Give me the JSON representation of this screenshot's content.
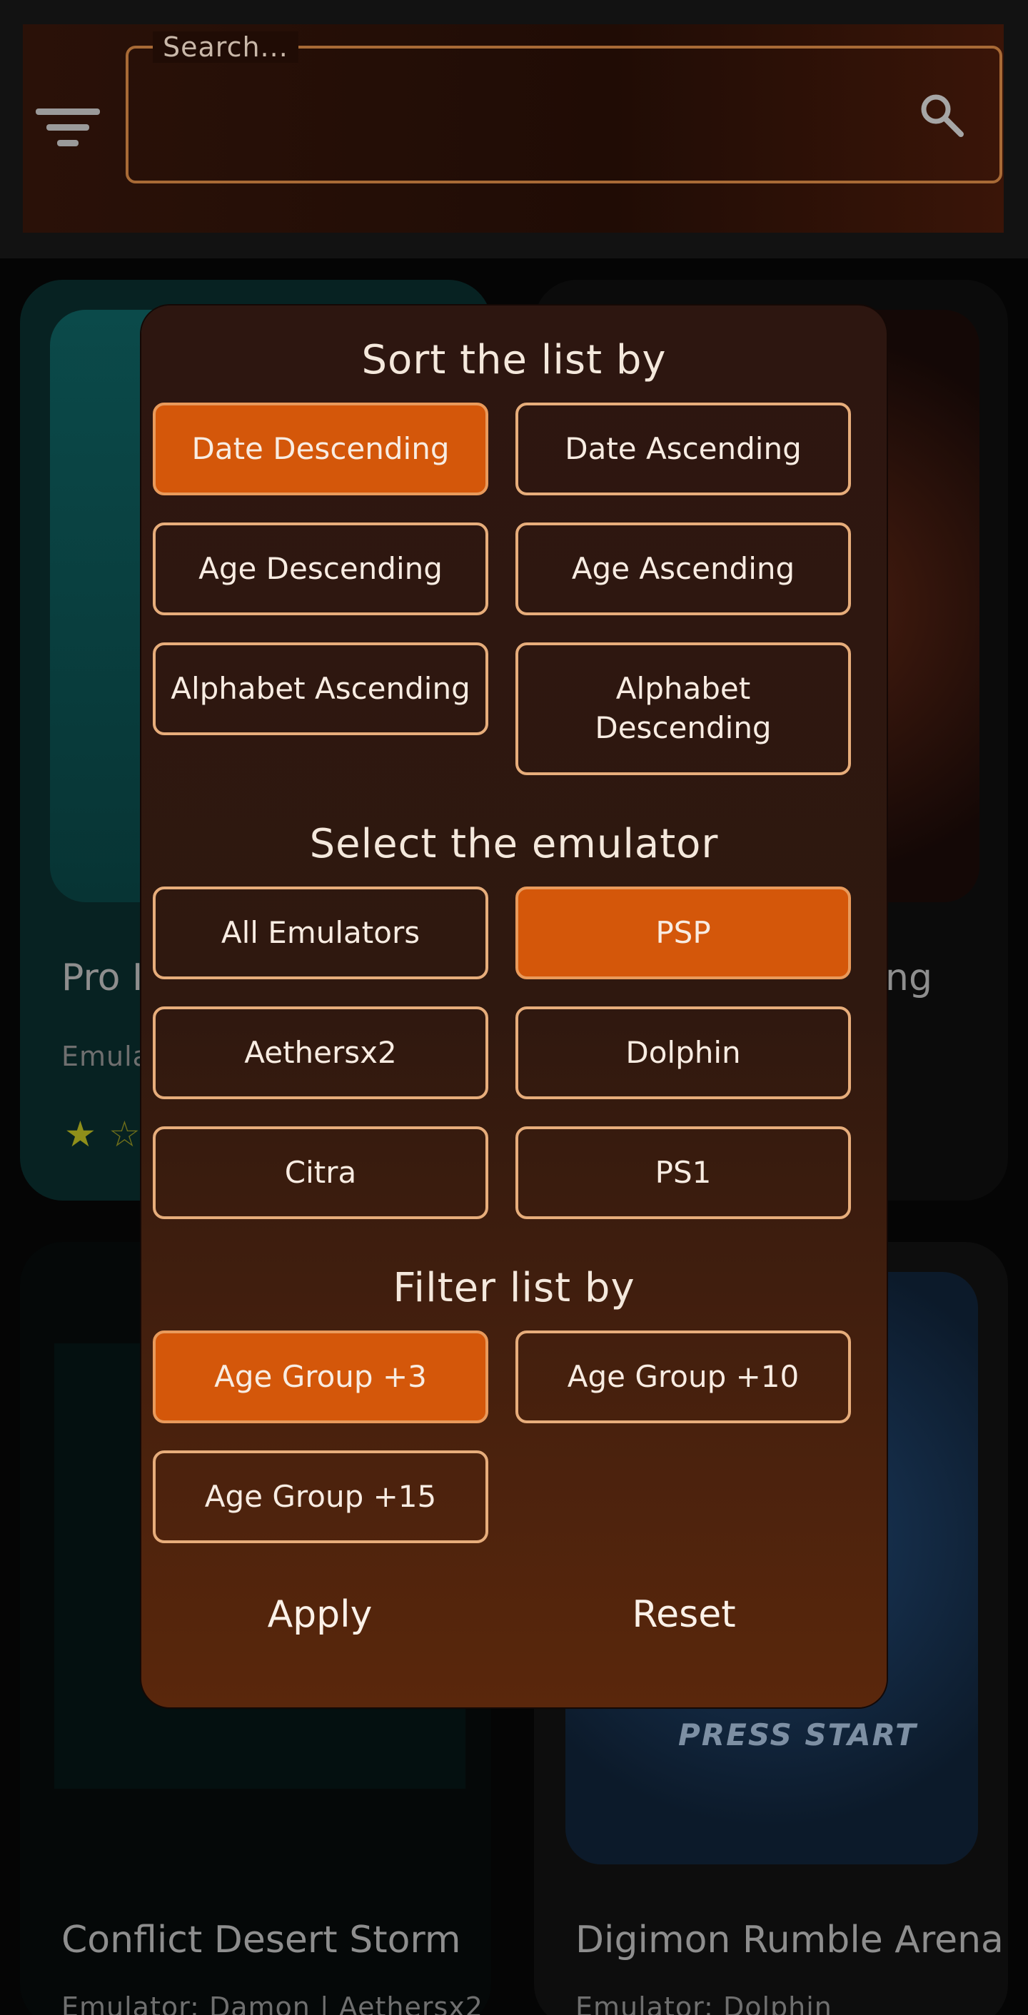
{
  "search": {
    "placeholder": "Search..."
  },
  "background_cards": {
    "card1": {
      "title": "Pro I",
      "subtitle": "Emula"
    },
    "card2": {
      "title_fragment": "ng"
    },
    "card3": {
      "title": "Conflict Desert Storm",
      "subtitle": "Emulator: Damon | Aethersx2"
    },
    "card4": {
      "title": "Digimon Rumble Arena",
      "subtitle": "Emulator: Dolphin",
      "thumb_text": "PRESS START"
    }
  },
  "modal": {
    "sort": {
      "title": "Sort the list by",
      "options": [
        {
          "label": "Date Descending",
          "active": true
        },
        {
          "label": "Date Ascending",
          "active": false
        },
        {
          "label": "Age Descending",
          "active": false
        },
        {
          "label": "Age Ascending",
          "active": false
        },
        {
          "label": "Alphabet Ascending",
          "active": false
        },
        {
          "label": "Alphabet Descending",
          "active": false
        }
      ]
    },
    "emulator": {
      "title": "Select the emulator",
      "options": [
        {
          "label": "All Emulators",
          "active": false
        },
        {
          "label": "PSP",
          "active": true
        },
        {
          "label": "Aethersx2",
          "active": false
        },
        {
          "label": "Dolphin",
          "active": false
        },
        {
          "label": "Citra",
          "active": false
        },
        {
          "label": "PS1",
          "active": false
        }
      ]
    },
    "filter": {
      "title": "Filter list by",
      "options": [
        {
          "label": "Age Group +3",
          "active": true
        },
        {
          "label": "Age Group +10",
          "active": false
        },
        {
          "label": "Age Group +15",
          "active": false
        }
      ]
    },
    "actions": {
      "apply": "Apply",
      "reset": "Reset"
    }
  },
  "colors": {
    "accent": "#d4570a",
    "border": "#e7ad7b",
    "modal_bg": "#2d1610"
  },
  "icons": {
    "filter": "filter-list-icon",
    "search": "search-icon",
    "star": "star-icon"
  }
}
